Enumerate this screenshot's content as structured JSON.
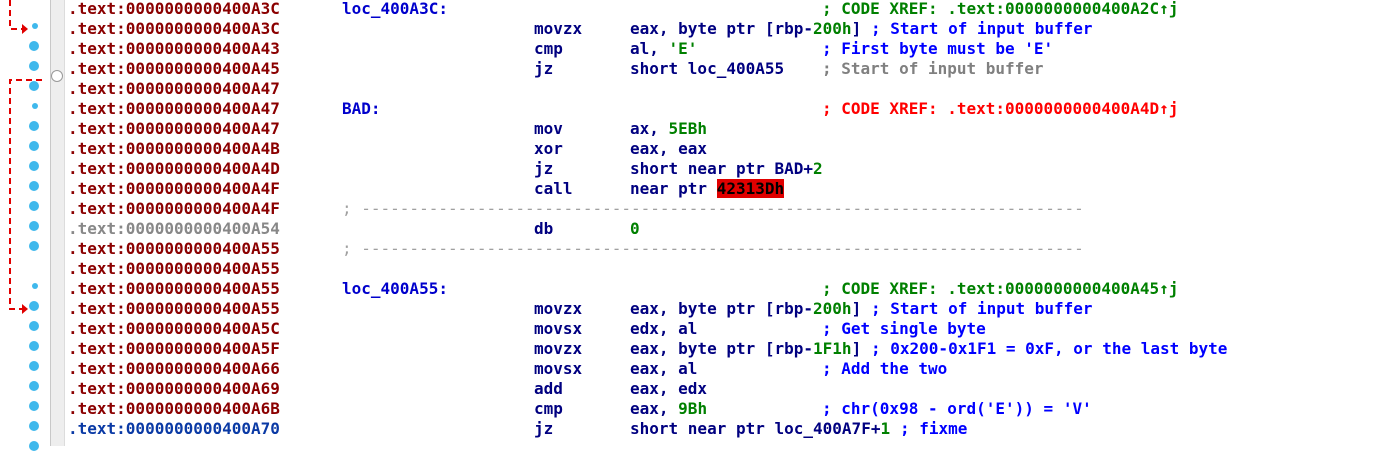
{
  "colors": {
    "address": "#8b0000",
    "mnemonic": "#000080",
    "comment": "#0000ff",
    "xref_green": "#008000",
    "xref_red": "#ff0000",
    "highlight": "#e00000",
    "gutter_dot": "#3fb8ec"
  },
  "lines": [
    {
      "addr": ".text:0000000000400A3C",
      "label": "loc_400A3C:",
      "xref": "; CODE XREF: .text:0000000000400A2C↑j"
    },
    {
      "addr": ".text:0000000000400A3C",
      "mnem": "movzx",
      "ops_pre": "eax, byte ptr [rbp-",
      "ops_num": "200h",
      "ops_post": "]",
      "comment": "; Start of input buffer"
    },
    {
      "addr": ".text:0000000000400A43",
      "mnem": "cmp",
      "ops_pre": "al, ",
      "ops_str": "'E'",
      "comment": "; First byte must be 'E'"
    },
    {
      "addr": ".text:0000000000400A45",
      "mnem": "jz",
      "ops_pre": "short loc_400A55",
      "comment": "; Start of input buffer"
    },
    {
      "addr": ".text:0000000000400A47"
    },
    {
      "addr": ".text:0000000000400A47",
      "label": "BAD:",
      "xref": "; CODE XREF: .text:0000000000400A4D↑j"
    },
    {
      "addr": ".text:0000000000400A47",
      "mnem": "mov",
      "ops_pre": "ax, ",
      "ops_num": "5EBh"
    },
    {
      "addr": ".text:0000000000400A4B",
      "mnem": "xor",
      "ops_pre": "eax, eax"
    },
    {
      "addr": ".text:0000000000400A4D",
      "mnem": "jz",
      "ops_pre": "short near ptr BAD+",
      "ops_num": "2"
    },
    {
      "addr": ".text:0000000000400A4F",
      "mnem": "call",
      "ops_pre": "near ptr ",
      "ops_hl": "42313Dh"
    },
    {
      "addr": ".text:0000000000400A4F",
      "sep": "; ---------------------------------------------------------------------------"
    },
    {
      "addr": ".text:0000000000400A54",
      "mnem": "db",
      "ops_num": "0"
    },
    {
      "addr": ".text:0000000000400A55",
      "sep": "; ---------------------------------------------------------------------------"
    },
    {
      "addr": ".text:0000000000400A55"
    },
    {
      "addr": ".text:0000000000400A55",
      "label": "loc_400A55:",
      "xref": "; CODE XREF: .text:0000000000400A45↑j"
    },
    {
      "addr": ".text:0000000000400A55",
      "mnem": "movzx",
      "ops_pre": "eax, byte ptr [rbp-",
      "ops_num": "200h",
      "ops_post": "]",
      "comment": "; Start of input buffer"
    },
    {
      "addr": ".text:0000000000400A5C",
      "mnem": "movsx",
      "ops_pre": "edx, al",
      "comment": "; Get single byte"
    },
    {
      "addr": ".text:0000000000400A5F",
      "mnem": "movzx",
      "ops_pre": "eax, byte ptr [rbp-",
      "ops_num": "1F1h",
      "ops_post": "]",
      "comment": "; 0x200-0x1F1 = 0xF, or the last byte"
    },
    {
      "addr": ".text:0000000000400A66",
      "mnem": "movsx",
      "ops_pre": "eax, al",
      "comment": "; Add the two"
    },
    {
      "addr": ".text:0000000000400A69",
      "mnem": "add",
      "ops_pre": "eax, edx"
    },
    {
      "addr": ".text:0000000000400A6B",
      "mnem": "cmp",
      "ops_pre": "eax, ",
      "ops_num": "9Bh",
      "comment": "; chr(0x98 - ord('E')) = 'V'"
    },
    {
      "addr": ".text:0000000000400A70",
      "mnem": "jz",
      "ops_pre": "short near ptr loc_400A7F+",
      "ops_num": "1",
      "comment": "; fixme"
    }
  ]
}
